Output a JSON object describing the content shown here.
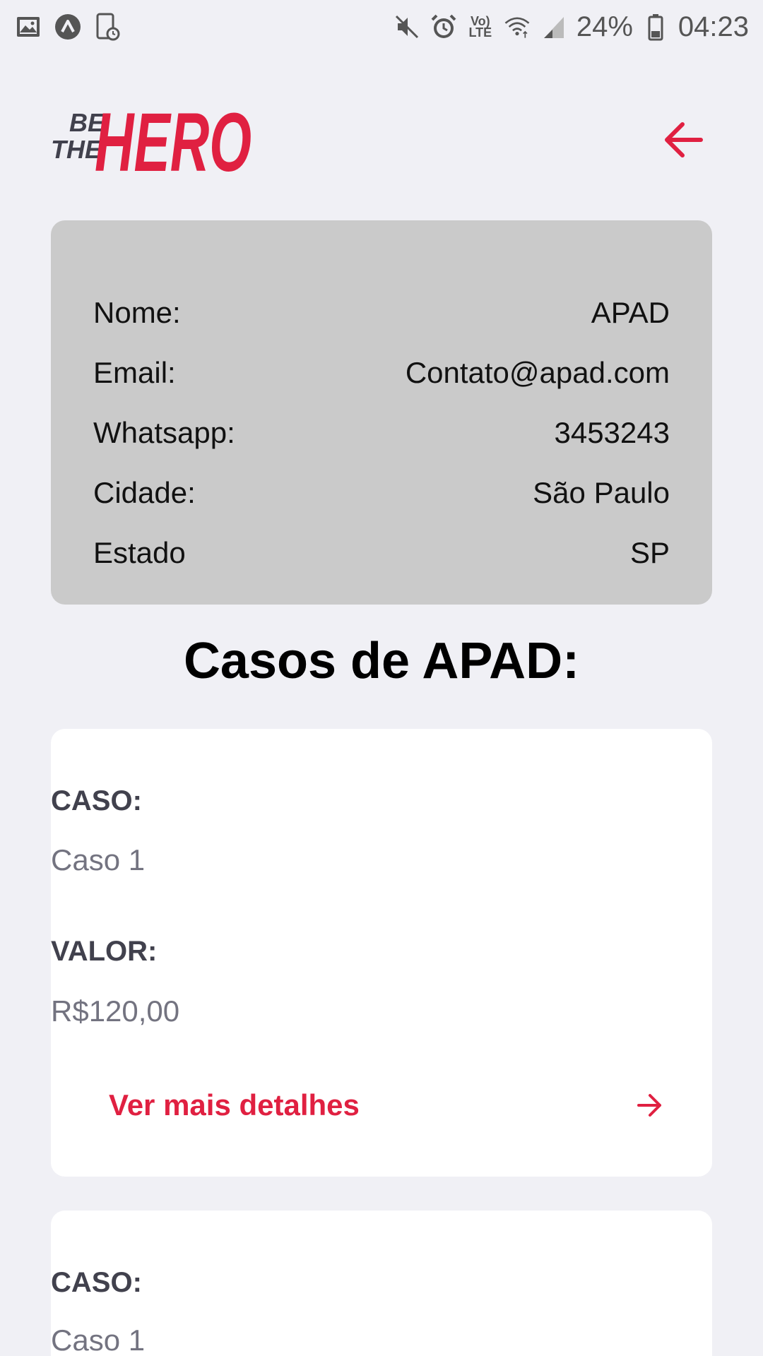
{
  "status_bar": {
    "battery": "24%",
    "time": "04:23",
    "network_label_top": "Vo)",
    "network_label_bottom": "LTE"
  },
  "header": {
    "logo_text_small_1": "BE",
    "logo_text_small_2": "THE",
    "logo_text_large": "HERO",
    "back_icon": "arrow-left-icon"
  },
  "ong_info": {
    "rows": [
      {
        "label": "Nome:",
        "value": "APAD"
      },
      {
        "label": "Email:",
        "value": "Contato@apad.com"
      },
      {
        "label": "Whatsapp:",
        "value": "3453243"
      },
      {
        "label": "Cidade:",
        "value": "São Paulo"
      },
      {
        "label": "Estado",
        "value": "SP"
      }
    ]
  },
  "cases_title": "Casos de APAD:",
  "cases": [
    {
      "case_label": "CASO:",
      "case_value": "Caso 1",
      "value_label": "VALOR:",
      "value_value": "R$120,00",
      "details_label": "Ver mais detalhes"
    },
    {
      "case_label": "CASO:",
      "case_value": "Caso 1"
    }
  ],
  "colors": {
    "brand_red": "#e02041",
    "background": "#f0f0f5",
    "info_card": "#cacaca"
  }
}
